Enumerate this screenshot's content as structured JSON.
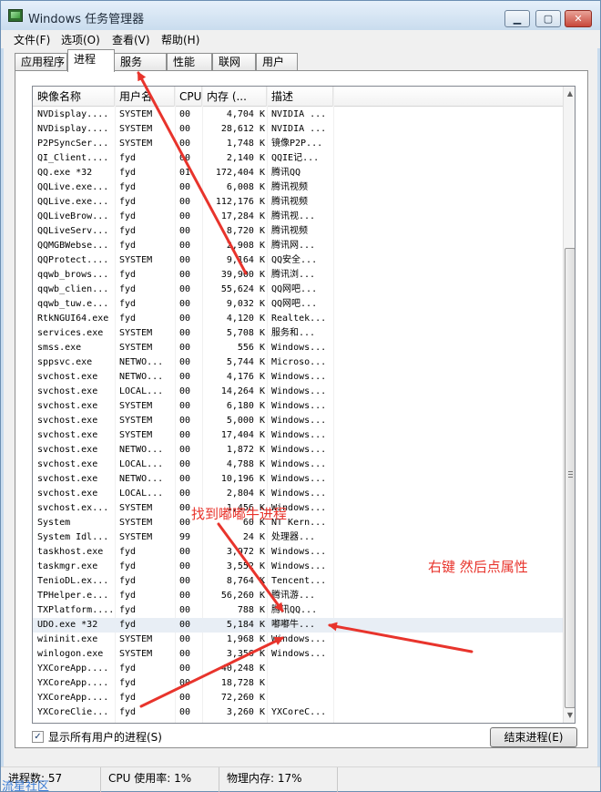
{
  "window": {
    "title": "Windows 任务管理器",
    "btn_min": "▁",
    "btn_max": "▢",
    "btn_close": "✕"
  },
  "menu": [
    "文件(F)",
    "选项(O)",
    "查看(V)",
    "帮助(H)"
  ],
  "tabs": [
    {
      "label": "应用程序",
      "active": false
    },
    {
      "label": "进程",
      "active": true
    },
    {
      "label": "服务",
      "active": false
    },
    {
      "label": "性能",
      "active": false
    },
    {
      "label": "联网",
      "active": false
    },
    {
      "label": "用户",
      "active": false
    }
  ],
  "columns": {
    "name": "映像名称",
    "user": "用户名",
    "cpu": "CPU",
    "mem": "内存 (...",
    "desc": "描述"
  },
  "processes": [
    {
      "name": "NVDisplay....",
      "user": "SYSTEM",
      "cpu": "00",
      "mem": "4,704 K",
      "desc": "NVIDIA ..."
    },
    {
      "name": "NVDisplay....",
      "user": "SYSTEM",
      "cpu": "00",
      "mem": "28,612 K",
      "desc": "NVIDIA ..."
    },
    {
      "name": "P2PSyncSer...",
      "user": "SYSTEM",
      "cpu": "00",
      "mem": "1,748 K",
      "desc": "镜像P2P..."
    },
    {
      "name": "QI_Client....",
      "user": "fyd",
      "cpu": "00",
      "mem": "2,140 K",
      "desc": "QQIE记..."
    },
    {
      "name": "QQ.exe *32",
      "user": "fyd",
      "cpu": "01",
      "mem": "172,404 K",
      "desc": "腾讯QQ"
    },
    {
      "name": "QQLive.exe...",
      "user": "fyd",
      "cpu": "00",
      "mem": "6,008 K",
      "desc": "腾讯视频"
    },
    {
      "name": "QQLive.exe...",
      "user": "fyd",
      "cpu": "00",
      "mem": "112,176 K",
      "desc": "腾讯视频"
    },
    {
      "name": "QQLiveBrow...",
      "user": "fyd",
      "cpu": "00",
      "mem": "17,284 K",
      "desc": "腾讯视..."
    },
    {
      "name": "QQLiveServ...",
      "user": "fyd",
      "cpu": "00",
      "mem": "8,720 K",
      "desc": "腾讯视频"
    },
    {
      "name": "QQMGBWebse...",
      "user": "fyd",
      "cpu": "00",
      "mem": "2,908 K",
      "desc": "腾讯网..."
    },
    {
      "name": "QQProtect....",
      "user": "SYSTEM",
      "cpu": "00",
      "mem": "9,164 K",
      "desc": "QQ安全..."
    },
    {
      "name": "qqwb_brows...",
      "user": "fyd",
      "cpu": "00",
      "mem": "39,900 K",
      "desc": "腾讯浏..."
    },
    {
      "name": "qqwb_clien...",
      "user": "fyd",
      "cpu": "00",
      "mem": "55,624 K",
      "desc": "QQ网吧..."
    },
    {
      "name": "qqwb_tuw.e...",
      "user": "fyd",
      "cpu": "00",
      "mem": "9,032 K",
      "desc": "QQ网吧..."
    },
    {
      "name": "RtkNGUI64.exe",
      "user": "fyd",
      "cpu": "00",
      "mem": "4,120 K",
      "desc": "Realtek..."
    },
    {
      "name": "services.exe",
      "user": "SYSTEM",
      "cpu": "00",
      "mem": "5,708 K",
      "desc": "服务和..."
    },
    {
      "name": "smss.exe",
      "user": "SYSTEM",
      "cpu": "00",
      "mem": "556 K",
      "desc": "Windows..."
    },
    {
      "name": "sppsvc.exe",
      "user": "NETWO...",
      "cpu": "00",
      "mem": "5,744 K",
      "desc": "Microso..."
    },
    {
      "name": "svchost.exe",
      "user": "NETWO...",
      "cpu": "00",
      "mem": "4,176 K",
      "desc": "Windows..."
    },
    {
      "name": "svchost.exe",
      "user": "LOCAL...",
      "cpu": "00",
      "mem": "14,264 K",
      "desc": "Windows..."
    },
    {
      "name": "svchost.exe",
      "user": "SYSTEM",
      "cpu": "00",
      "mem": "6,180 K",
      "desc": "Windows..."
    },
    {
      "name": "svchost.exe",
      "user": "SYSTEM",
      "cpu": "00",
      "mem": "5,000 K",
      "desc": "Windows..."
    },
    {
      "name": "svchost.exe",
      "user": "SYSTEM",
      "cpu": "00",
      "mem": "17,404 K",
      "desc": "Windows..."
    },
    {
      "name": "svchost.exe",
      "user": "NETWO...",
      "cpu": "00",
      "mem": "1,872 K",
      "desc": "Windows..."
    },
    {
      "name": "svchost.exe",
      "user": "LOCAL...",
      "cpu": "00",
      "mem": "4,788 K",
      "desc": "Windows..."
    },
    {
      "name": "svchost.exe",
      "user": "NETWO...",
      "cpu": "00",
      "mem": "10,196 K",
      "desc": "Windows..."
    },
    {
      "name": "svchost.exe",
      "user": "LOCAL...",
      "cpu": "00",
      "mem": "2,804 K",
      "desc": "Windows..."
    },
    {
      "name": "svchost.ex...",
      "user": "SYSTEM",
      "cpu": "00",
      "mem": "1,456 K",
      "desc": "Windows..."
    },
    {
      "name": "System",
      "user": "SYSTEM",
      "cpu": "00",
      "mem": "60 K",
      "desc": "NT Kern..."
    },
    {
      "name": "System Idl...",
      "user": "SYSTEM",
      "cpu": "99",
      "mem": "24 K",
      "desc": "处理器..."
    },
    {
      "name": "taskhost.exe",
      "user": "fyd",
      "cpu": "00",
      "mem": "3,972 K",
      "desc": "Windows..."
    },
    {
      "name": "taskmgr.exe",
      "user": "fyd",
      "cpu": "00",
      "mem": "3,552 K",
      "desc": "Windows..."
    },
    {
      "name": "TenioDL.ex...",
      "user": "fyd",
      "cpu": "00",
      "mem": "8,764 K",
      "desc": "Tencent..."
    },
    {
      "name": "TPHelper.e...",
      "user": "fyd",
      "cpu": "00",
      "mem": "56,260 K",
      "desc": "腾讯游..."
    },
    {
      "name": "TXPlatform....",
      "user": "fyd",
      "cpu": "00",
      "mem": "788 K",
      "desc": "腾讯QQ..."
    },
    {
      "name": "UDO.exe *32",
      "user": "fyd",
      "cpu": "00",
      "mem": "5,184 K",
      "desc": "嘟嘟牛...",
      "selected": true
    },
    {
      "name": "wininit.exe",
      "user": "SYSTEM",
      "cpu": "00",
      "mem": "1,968 K",
      "desc": "Windows..."
    },
    {
      "name": "winlogon.exe",
      "user": "SYSTEM",
      "cpu": "00",
      "mem": "3,356 K",
      "desc": "Windows..."
    },
    {
      "name": "YXCoreApp....",
      "user": "fyd",
      "cpu": "00",
      "mem": "40,248 K",
      "desc": ""
    },
    {
      "name": "YXCoreApp....",
      "user": "fyd",
      "cpu": "00",
      "mem": "18,728 K",
      "desc": ""
    },
    {
      "name": "YXCoreApp....",
      "user": "fyd",
      "cpu": "00",
      "mem": "72,260 K",
      "desc": ""
    },
    {
      "name": "YXCoreClie...",
      "user": "fyd",
      "cpu": "00",
      "mem": "3,260 K",
      "desc": "YXCoreC..."
    }
  ],
  "show_all_label": "显示所有用户的进程(S)",
  "show_all_checked": "✓",
  "end_process_label": "结束进程(E)",
  "status": {
    "processes": "进程数: 57",
    "cpu": "CPU 使用率: 1%",
    "memory": "物理内存: 17%"
  },
  "annotations": {
    "find_process": "找到嘟嘟牛进程",
    "right_click": "右键 然后点属性"
  },
  "watermark": "流星社区",
  "annotation_color": "#e8342c"
}
